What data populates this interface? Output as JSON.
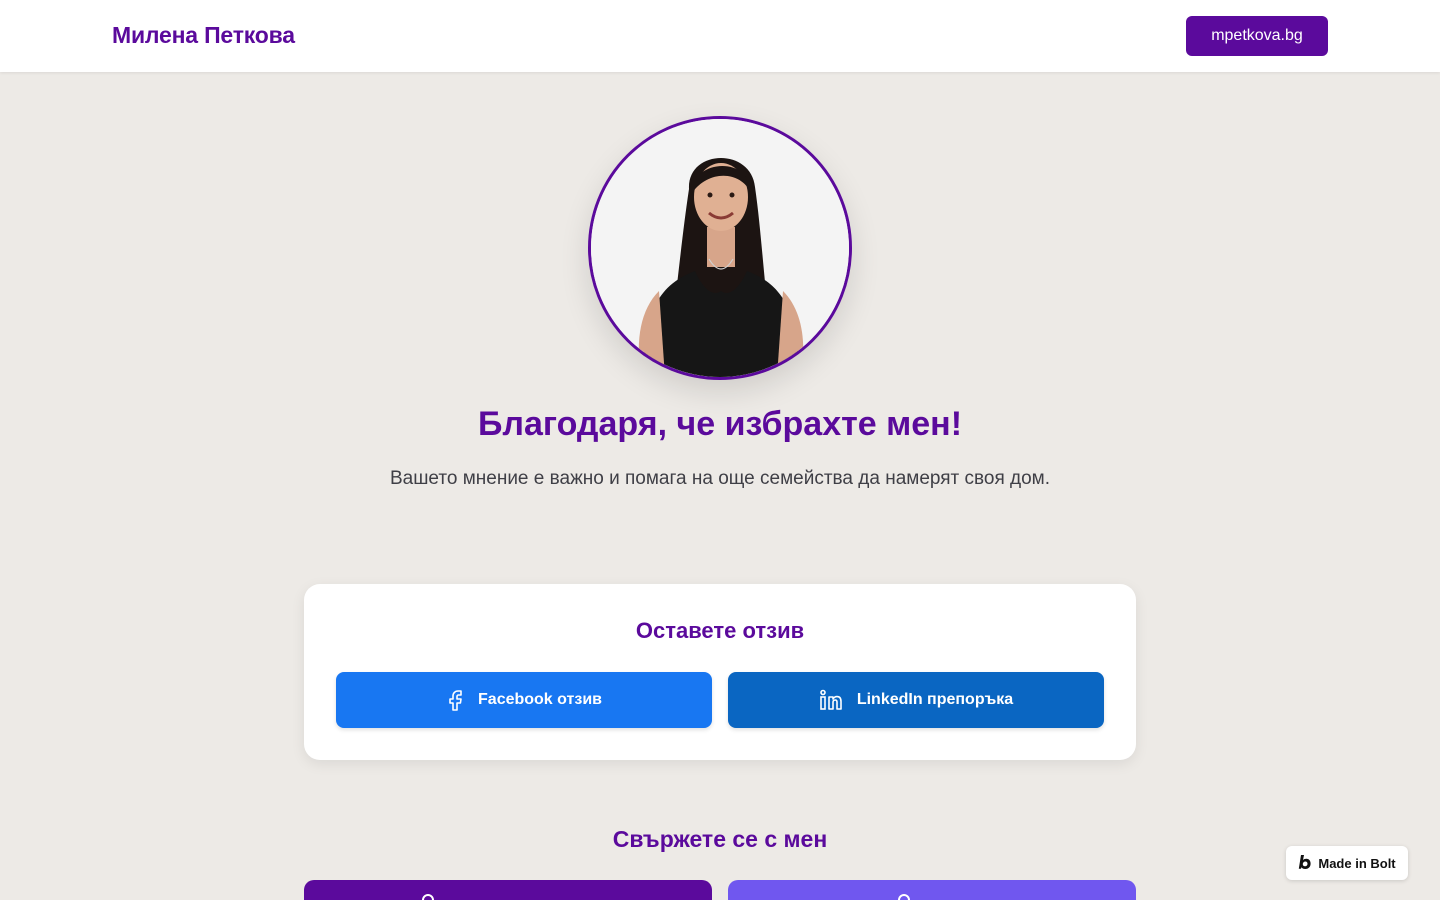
{
  "header": {
    "brand_name": "Милена Петкова",
    "site_button_label": "mpetkova.bg"
  },
  "hero": {
    "headline": "Благодаря, че избрахте мен!",
    "subtext": "Вашето мнение е важно и помага на още семейства да намерят своя дом."
  },
  "review": {
    "title": "Оставете отзив",
    "facebook_label": "Facebook отзив",
    "linkedin_label": "LinkedIn препоръка"
  },
  "contact": {
    "title": "Свържете се с мен"
  },
  "badge": {
    "label": "Made in Bolt"
  },
  "colors": {
    "brand_purple": "#5b0a9c",
    "facebook_blue": "#1877f2",
    "linkedin_blue": "#0a66c2",
    "secondary_violet": "#7057ef",
    "page_background": "#edeae6"
  },
  "icons": {
    "facebook": "facebook-icon",
    "linkedin": "linkedin-icon",
    "bolt": "bolt-logo-icon"
  }
}
